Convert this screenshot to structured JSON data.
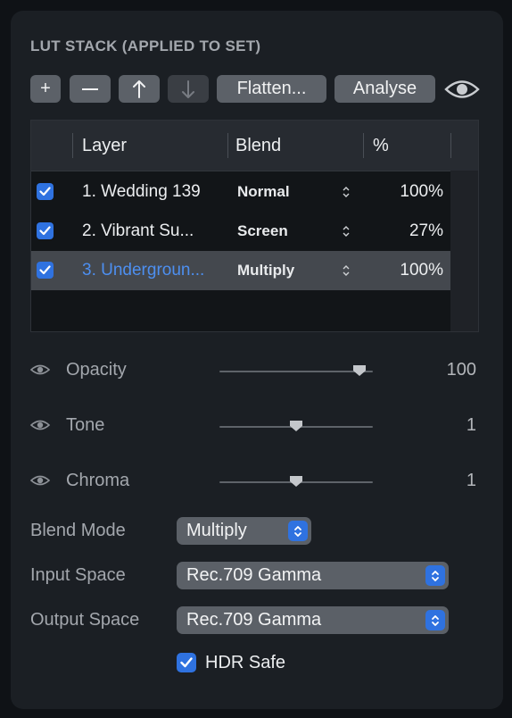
{
  "panel": {
    "title": "LUT STACK (APPLIED TO SET)",
    "toolbar": {
      "add_label": "+",
      "flatten_label": "Flatten...",
      "analyse_label": "Analyse"
    },
    "table": {
      "columns": [
        "Layer",
        "Blend",
        "%"
      ],
      "rows": [
        {
          "checked": true,
          "layer": "1. Wedding 139",
          "blend": "Normal",
          "percent": "100%"
        },
        {
          "checked": true,
          "layer": "2. Vibrant Su...",
          "blend": "Screen",
          "percent": "27%"
        },
        {
          "checked": true,
          "layer": "3. Undergroun...",
          "blend": "Multiply",
          "percent": "100%",
          "selected": true
        }
      ]
    },
    "sliders": [
      {
        "label": "Opacity",
        "value": "100",
        "fraction": 0.91
      },
      {
        "label": "Tone",
        "value": "1",
        "fraction": 0.5
      },
      {
        "label": "Chroma",
        "value": "1",
        "fraction": 0.5
      }
    ],
    "blend_mode": {
      "label": "Blend Mode",
      "value": "Multiply"
    },
    "input_space": {
      "label": "Input Space",
      "value": "Rec.709 Gamma"
    },
    "output_space": {
      "label": "Output Space",
      "value": "Rec.709 Gamma"
    },
    "hdr_safe": {
      "label": "HDR Safe",
      "checked": true
    }
  },
  "colors": {
    "accent": "#2f72e0",
    "selected_text": "#4d8ff0",
    "panel_bg": "#1b1f24"
  }
}
